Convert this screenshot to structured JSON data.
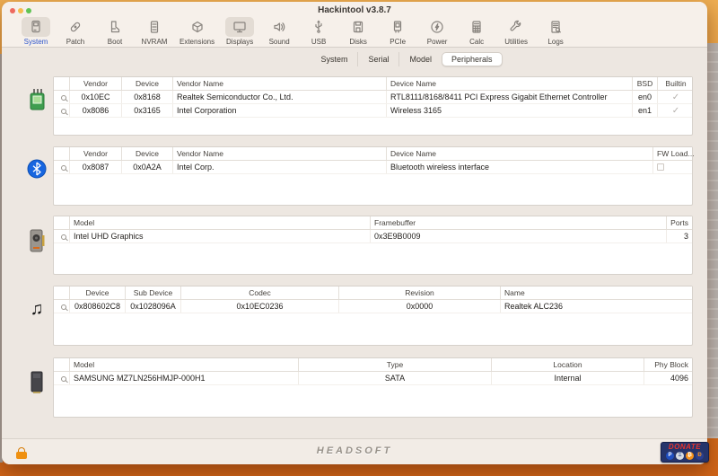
{
  "window": {
    "title": "Hackintool v3.8.7"
  },
  "toolbar": {
    "selected": "System",
    "items": [
      {
        "label": "System"
      },
      {
        "label": "Patch"
      },
      {
        "label": "Boot"
      },
      {
        "label": "NVRAM"
      },
      {
        "label": "Extensions"
      },
      {
        "label": "Displays"
      },
      {
        "label": "Sound"
      },
      {
        "label": "USB"
      },
      {
        "label": "Disks"
      },
      {
        "label": "PCIe"
      },
      {
        "label": "Power"
      },
      {
        "label": "Calc"
      },
      {
        "label": "Utilities"
      },
      {
        "label": "Logs"
      }
    ]
  },
  "tabs": {
    "items": [
      "System",
      "Serial",
      "Model",
      "Peripherals"
    ],
    "selected": "Peripherals"
  },
  "sections": [
    {
      "id": "network",
      "columns": [
        "Vendor",
        "Device",
        "Vendor Name",
        "Device Name",
        "BSD",
        "Builtin"
      ],
      "rows": [
        [
          "0x10EC",
          "0x8168",
          "Realtek Semiconductor Co., Ltd.",
          "RTL8111/8168/8411 PCI Express Gigabit Ethernet Controller",
          "en0",
          true
        ],
        [
          "0x8086",
          "0x3165",
          "Intel Corporation",
          "Wireless 3165",
          "en1",
          true
        ]
      ]
    },
    {
      "id": "bluetooth",
      "columns": [
        "Vendor",
        "Device",
        "Vendor Name",
        "Device Name",
        "FW Load..."
      ],
      "rows": [
        [
          "0x8087",
          "0x0A2A",
          "Intel Corp.",
          "Bluetooth wireless interface",
          false
        ]
      ]
    },
    {
      "id": "graphics",
      "columns": [
        "Model",
        "Framebuffer",
        "Ports"
      ],
      "rows": [
        [
          "Intel UHD Graphics",
          "0x3E9B0009",
          "3"
        ]
      ]
    },
    {
      "id": "audio",
      "columns": [
        "Device",
        "Sub Device",
        "Codec",
        "Revision",
        "Name"
      ],
      "rows": [
        [
          "0x808602C8",
          "0x1028096A",
          "0x10EC0236",
          "0x0000",
          "Realtek ALC236"
        ]
      ]
    },
    {
      "id": "storage",
      "columns": [
        "Model",
        "Type",
        "Location",
        "Phy Block"
      ],
      "rows": [
        [
          "SAMSUNG MZ7LN256HMJP-000H1",
          "SATA",
          "Internal",
          "4096"
        ]
      ]
    }
  ],
  "footer": {
    "brand": "HEADSOFT",
    "donate_label": "DONATE",
    "coins": [
      "P",
      "Ξ",
      "₿",
      "Ð"
    ]
  },
  "colors": {
    "accent_blue": "#2e55cc",
    "desktop_orange": "#e08a2a",
    "donate_red": "#e8332c",
    "bitcoin_orange": "#f7931a",
    "ethernet_green": "#3f9e4f",
    "bluetooth_blue": "#1766e0"
  }
}
